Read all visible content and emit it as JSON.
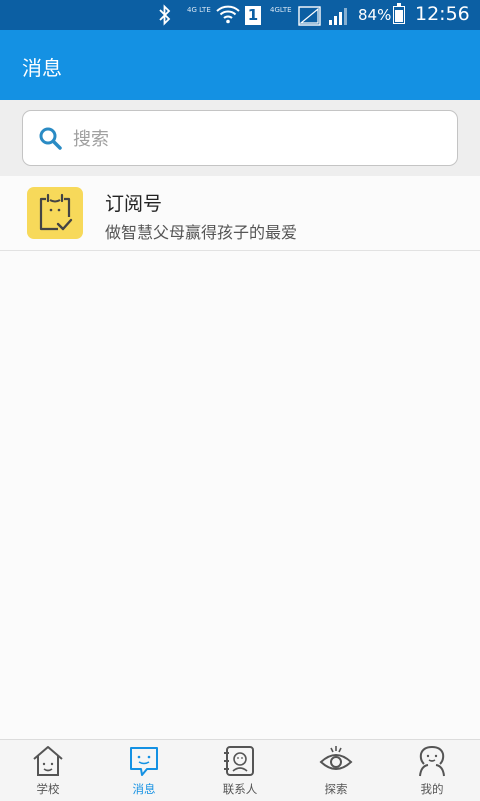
{
  "status_bar": {
    "network_small_1": "4G LTE",
    "network_small_2": "4GLTE",
    "sim_slot": "1",
    "battery": "84%",
    "battery_level": 0.84,
    "time": "12:56"
  },
  "header": {
    "title": "消息"
  },
  "search": {
    "placeholder": "搜索",
    "value": ""
  },
  "messages": [
    {
      "name": "订阅号",
      "preview": "做智慧父母赢得孩子的最爱",
      "icon": "subscription-icon"
    }
  ],
  "bottom_nav": {
    "items": [
      {
        "label": "学校",
        "icon": "school-icon",
        "active": false
      },
      {
        "label": "消息",
        "icon": "message-icon",
        "active": true
      },
      {
        "label": "联系人",
        "icon": "contacts-icon",
        "active": false
      },
      {
        "label": "探索",
        "icon": "explore-icon",
        "active": false
      },
      {
        "label": "我的",
        "icon": "profile-icon",
        "active": false
      }
    ]
  },
  "colors": {
    "status_bar": "#0c5fa3",
    "header": "#1491e3",
    "active_tab": "#1491e3",
    "avatar_bg": "#f7d95a"
  }
}
